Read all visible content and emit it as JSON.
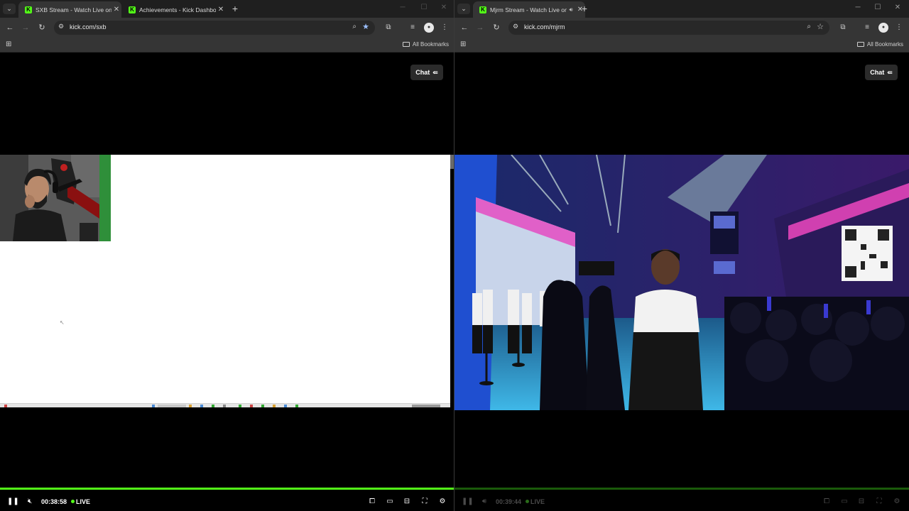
{
  "left": {
    "tabs": [
      {
        "title": "SXB Stream - Watch Live on Kick",
        "active": true
      },
      {
        "title": "Achievements - Kick Dashboard",
        "active": false
      }
    ],
    "url": "kick.com/sxb",
    "bookmarks_label": "All Bookmarks",
    "chat_label": "Chat",
    "player": {
      "time": "00:38:58",
      "live_label": "LIVE",
      "progress": 1.0
    }
  },
  "right": {
    "tabs": [
      {
        "title": "Mjrm Stream - Watch Live on Kick",
        "active": true
      }
    ],
    "url": "kick.com/mjrm",
    "bookmarks_label": "All Bookmarks",
    "chat_label": "Chat",
    "player": {
      "time": "00:39:44",
      "live_label": "LIVE",
      "progress": 1.0
    }
  },
  "colors": {
    "accent": "#53fc18",
    "chrome_bg": "#1f1f1f",
    "toolbar_bg": "#353535"
  },
  "icons": {
    "tab_favicon": "kick-logo-icon",
    "close": "close-icon",
    "new_tab": "plus-icon",
    "back": "back-arrow-icon",
    "forward": "forward-arrow-icon",
    "reload": "reload-icon",
    "site_info": "site-info-icon",
    "zoom": "zoom-icon",
    "bookmark": "star-icon",
    "extensions": "puzzle-icon",
    "media": "media-control-icon",
    "profile": "profile-avatar",
    "menu": "kebab-menu-icon",
    "apps": "apps-grid-icon",
    "folder": "folder-icon",
    "chat": "chat-collapse-icon",
    "pause": "pause-icon",
    "mute": "muted-speaker-icon",
    "pip": "picture-in-picture-icon",
    "theater": "theater-mode-icon",
    "clip": "clip-icon",
    "fullscreen": "fullscreen-icon",
    "settings": "settings-gear-icon"
  }
}
